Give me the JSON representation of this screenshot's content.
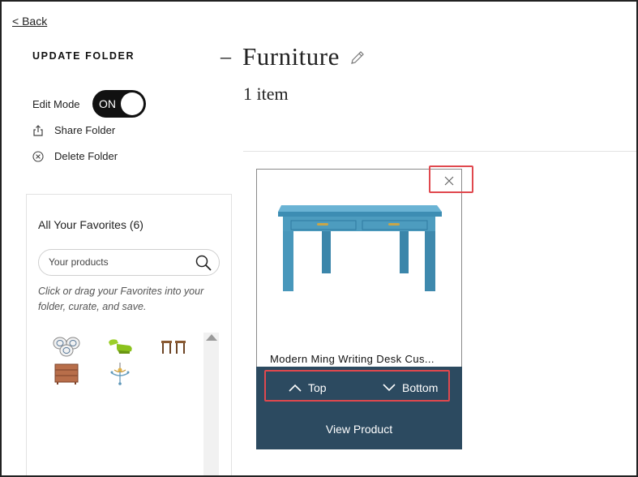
{
  "nav": {
    "back_label": "< Back"
  },
  "sidebar": {
    "title": "UPDATE FOLDER",
    "edit_mode": {
      "label": "Edit Mode",
      "state": "ON"
    },
    "actions": [
      {
        "label": "Share Folder",
        "icon": "share-icon"
      },
      {
        "label": "Delete Folder",
        "icon": "circle-x-icon"
      }
    ]
  },
  "folder": {
    "title": "Furniture",
    "item_count": "1 item"
  },
  "favorites": {
    "title": "All Your Favorites (6)",
    "search_placeholder": "Your products",
    "hint": "Click or drag your Favorites into your folder, curate, and save.",
    "items": [
      {
        "icon": "plates-thumbnail"
      },
      {
        "icon": "green-sofa-thumbnail"
      },
      {
        "icon": "side-tables-thumbnail"
      },
      {
        "icon": "dresser-thumbnail"
      },
      {
        "icon": "chandelier-thumbnail"
      }
    ]
  },
  "product_card": {
    "name": "Modern Ming Writing Desk Cus...",
    "move_top_label": "Top",
    "move_bottom_label": "Bottom",
    "view_label": "View Product",
    "image_icon": "blue-desk-image"
  },
  "colors": {
    "card_footer": "#2c4a60",
    "desk_blue": "#4d9cbf",
    "highlight": "#e0484e"
  }
}
